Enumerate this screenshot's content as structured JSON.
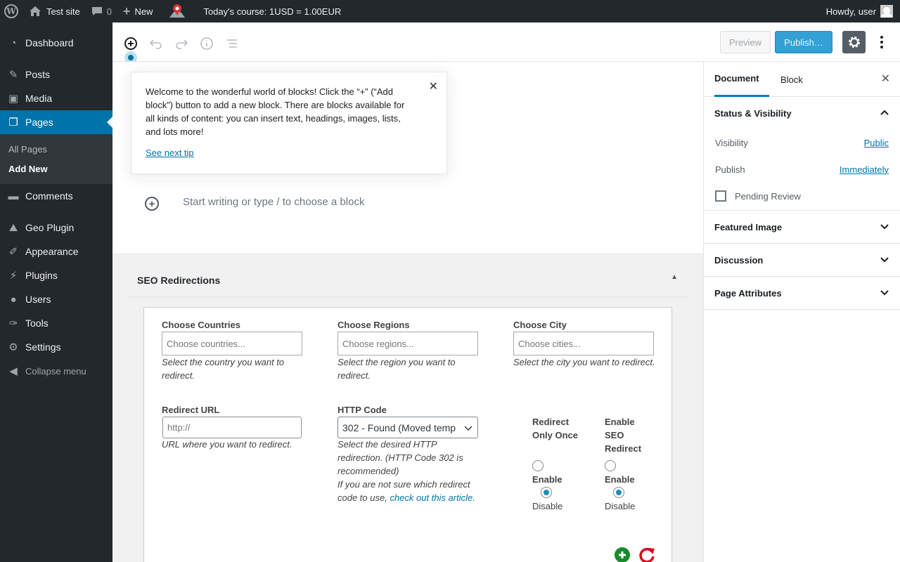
{
  "adminbar": {
    "site_name": "Test site",
    "comments_count": "0",
    "new_label": "New",
    "course_text": "Today's course: 1USD = 1.00EUR",
    "howdy": "Howdy, user"
  },
  "sidebar_menu": {
    "items": [
      {
        "label": "Dashboard"
      },
      {
        "label": "Posts"
      },
      {
        "label": "Media"
      },
      {
        "label": "Pages"
      },
      {
        "label": "Comments"
      },
      {
        "label": "Geo Plugin"
      },
      {
        "label": "Appearance"
      },
      {
        "label": "Plugins"
      },
      {
        "label": "Users"
      },
      {
        "label": "Tools"
      },
      {
        "label": "Settings"
      }
    ],
    "pages_submenu": [
      "All Pages",
      "Add New"
    ],
    "collapse": "Collapse menu"
  },
  "toolbar": {
    "preview_label": "Preview",
    "publish_label": "Publish…"
  },
  "tip": {
    "text": "Welcome to the wonderful world of blocks! Click the “+” (“Add block”) button to add a new block. There are blocks available for all kinds of content: you can insert text, headings, images, lists, and lots more!",
    "link": "See next tip"
  },
  "editor": {
    "placeholder": "Start writing or type / to choose a block"
  },
  "seo": {
    "title": "SEO Redirections",
    "countries_label": "Choose Countries",
    "countries_placeholder": "Choose countries...",
    "countries_desc": "Select the country you want to redirect.",
    "regions_label": "Choose Regions",
    "regions_placeholder": "Choose regions...",
    "regions_desc": "Select the region you want to redirect.",
    "city_label": "Choose City",
    "city_placeholder": "Choose cities...",
    "city_desc": "Select the city you want to redirect.",
    "url_label": "Redirect URL",
    "url_placeholder": "http://",
    "url_desc": "URL where you want to redirect.",
    "http_label": "HTTP Code",
    "http_value": "302 - Found (Moved temp",
    "http_desc1": "Select the desired HTTP redirection. (HTTP Code 302 is recommended)",
    "http_desc2": "If you are not sure which redirect code to use,",
    "http_link": "check out this article",
    "http_period": ".",
    "once_label": "Redirect Only Once",
    "seo_label": "Enable SEO Redirect",
    "enable": "Enable",
    "disable": "Disable"
  },
  "settings_panel": {
    "tab_document": "Document",
    "tab_block": "Block",
    "status_title": "Status & Visibility",
    "visibility_label": "Visibility",
    "visibility_value": "Public",
    "publish_label": "Publish",
    "publish_value": "Immediately",
    "pending_review": "Pending Review",
    "featured_image": "Featured Image",
    "discussion": "Discussion",
    "page_attributes": "Page Attributes"
  },
  "colors": {
    "accent": "#0073aa",
    "adminbar": "#23282d",
    "publish": "#33a0d6"
  }
}
